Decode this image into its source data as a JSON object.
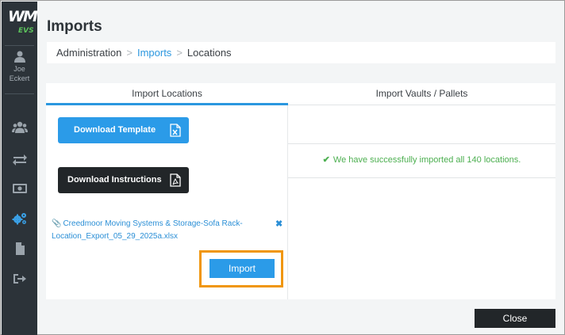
{
  "sidebar": {
    "logo_text": "WM",
    "logo_sub": "EVS",
    "user_first": "Joe",
    "user_last": "Eckert",
    "nav_icons": [
      "users-icon",
      "transfer-arrows-icon",
      "money-icon",
      "gears-icon",
      "document-icon",
      "logout-icon"
    ]
  },
  "header": {
    "title": "Imports",
    "breadcrumb": [
      "Administration",
      "Imports",
      "Locations"
    ]
  },
  "tabs": [
    {
      "label": "Import Locations",
      "active": true
    },
    {
      "label": "Import Vaults / Pallets",
      "active": false
    }
  ],
  "left_panel": {
    "download_template": "Download Template",
    "download_instructions": "Download Instructions",
    "file_line1": "Creedmoor Moving Systems & Storage-Sofa Rack-",
    "file_line2": "Location_Export_05_29_2025a.xlsx",
    "remove_icon": "✖",
    "import_label": "Import"
  },
  "right_panel": {
    "success_message": "We have successfully imported all 140 locations."
  },
  "footer": {
    "close_label": "Close"
  },
  "colors": {
    "accent": "#2b9be8",
    "dark_button": "#222629",
    "sidebar": "#2c3339",
    "success": "#4caf50",
    "highlight": "#f0960c"
  }
}
